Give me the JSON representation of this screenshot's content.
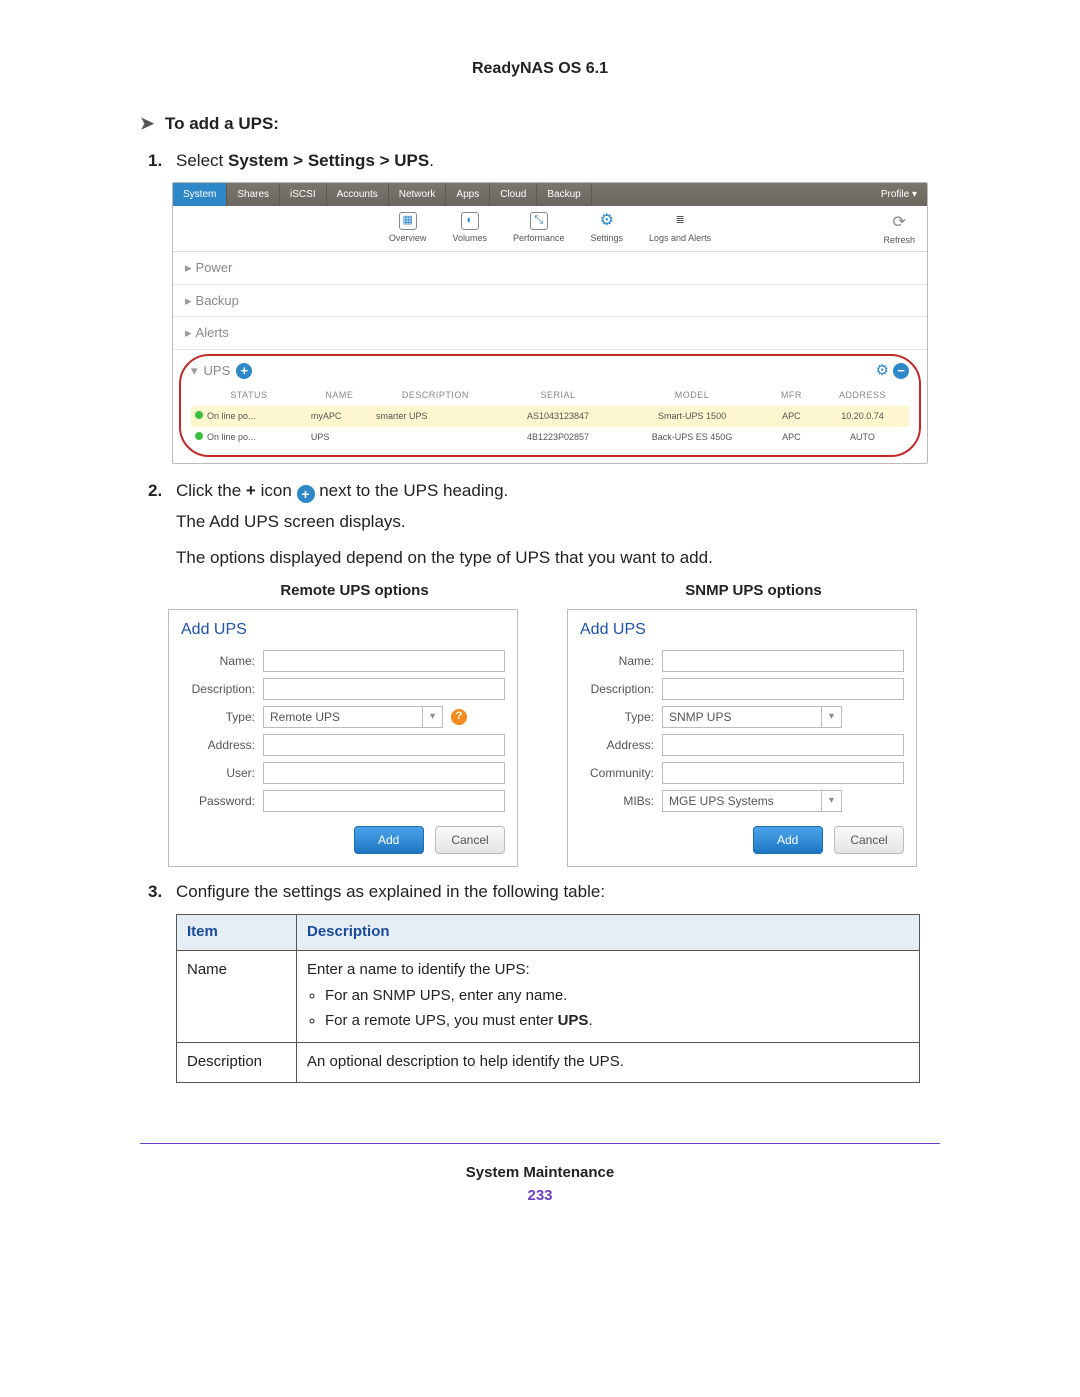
{
  "doc_header": "ReadyNAS OS 6.1",
  "section": {
    "heading": "To add a UPS:"
  },
  "step1": {
    "num": "1.",
    "prefix": "Select ",
    "path": "System > Settings > UPS",
    "suffix": "."
  },
  "sys": {
    "tabs": [
      "System",
      "Shares",
      "iSCSI",
      "Accounts",
      "Network",
      "Apps",
      "Cloud",
      "Backup"
    ],
    "profile": "Profile ▾",
    "toolbar": [
      "Overview",
      "Volumes",
      "Performance",
      "Settings",
      "Logs and Alerts"
    ],
    "refresh": "Refresh",
    "sections": [
      "Power",
      "Backup",
      "Alerts"
    ],
    "ups_label": "UPS",
    "ups_headers": [
      "STATUS",
      "NAME",
      "DESCRIPTION",
      "SERIAL",
      "MODEL",
      "MFR",
      "ADDRESS"
    ],
    "ups_rows": [
      {
        "status": "On line po...",
        "name": "myAPC",
        "desc": "smarter UPS",
        "serial": "AS1043123847",
        "model": "Smart-UPS 1500",
        "mfr": "APC",
        "address": "10.20.0.74",
        "hl": true
      },
      {
        "status": "On line po...",
        "name": "UPS",
        "desc": "",
        "serial": "4B1223P02857",
        "model": "Back-UPS ES 450G",
        "mfr": "APC",
        "address": "AUTO",
        "hl": false
      }
    ]
  },
  "step2": {
    "num": "2.",
    "pre": "Click the ",
    "bold": "+",
    "mid": " icon ",
    "post": " next to the UPS heading.",
    "line2": "The Add UPS screen displays.",
    "line3": "The options displayed depend on the type of UPS that you want to add."
  },
  "dialogs": {
    "remote_title": "Remote UPS options",
    "snmp_title": "SNMP UPS options",
    "add_ups": "Add UPS",
    "labels": {
      "name": "Name:",
      "description": "Description:",
      "type": "Type:",
      "address": "Address:",
      "user": "User:",
      "password": "Password:",
      "community": "Community:",
      "mibs": "MIBs:"
    },
    "remote_type_value": "Remote UPS",
    "snmp_type_value": "SNMP UPS",
    "mibs_value": "MGE UPS Systems",
    "add_btn": "Add",
    "cancel_btn": "Cancel"
  },
  "step3": {
    "num": "3.",
    "text": "Configure the settings as explained in the following table:"
  },
  "table": {
    "headers": [
      "Item",
      "Description"
    ],
    "rows": [
      {
        "item": "Name",
        "desc_intro": "Enter a name to identify the UPS:",
        "bullets": [
          {
            "pre": "For an SNMP UPS, enter any name."
          },
          {
            "pre": "For a remote UPS, you must enter ",
            "bold": "UPS",
            "post": "."
          }
        ]
      },
      {
        "item": "Description",
        "desc_intro": "An optional description to help identify the UPS."
      }
    ]
  },
  "footer": {
    "label": "System Maintenance",
    "page": "233"
  }
}
